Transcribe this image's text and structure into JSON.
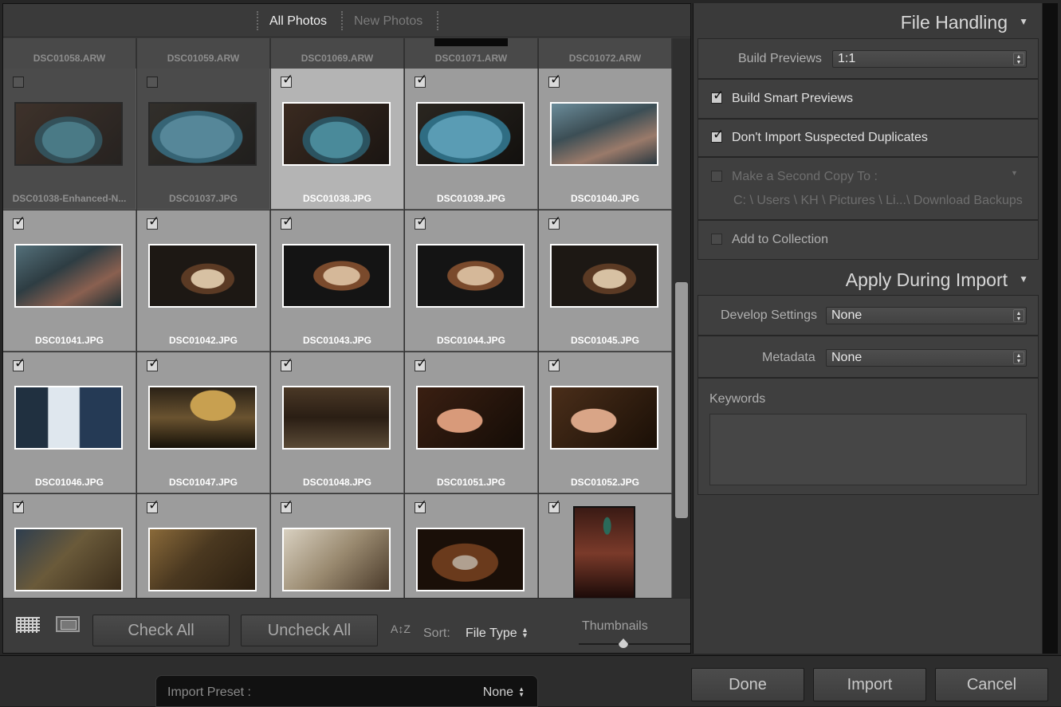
{
  "tabs": {
    "all_photos": "All Photos",
    "new_photos": "New Photos"
  },
  "grid": {
    "top_row_names": [
      "DSC01058.ARW",
      "DSC01059.ARW",
      "DSC01069.ARW",
      "DSC01071.ARW",
      "DSC01072.ARW"
    ],
    "rows": [
      [
        {
          "name": "DSC01038-Enhanced-N...",
          "checked": false,
          "thumb": "t-food1"
        },
        {
          "name": "DSC01037.JPG",
          "checked": false,
          "thumb": "t-food2"
        },
        {
          "name": "DSC01038.JPG",
          "checked": true,
          "selected": true,
          "thumb": "t-food1"
        },
        {
          "name": "DSC01039.JPG",
          "checked": true,
          "thumb": "t-food2"
        },
        {
          "name": "DSC01040.JPG",
          "checked": true,
          "thumb": "t-people"
        }
      ],
      [
        {
          "name": "DSC01041.JPG",
          "checked": true,
          "thumb": "t-people2"
        },
        {
          "name": "DSC01042.JPG",
          "checked": true,
          "thumb": "t-plate"
        },
        {
          "name": "DSC01043.JPG",
          "checked": true,
          "thumb": "t-plate2"
        },
        {
          "name": "DSC01044.JPG",
          "checked": true,
          "thumb": "t-plate2"
        },
        {
          "name": "DSC01045.JPG",
          "checked": true,
          "thumb": "t-plate"
        }
      ],
      [
        {
          "name": "DSC01046.JPG",
          "checked": true,
          "thumb": "t-sign"
        },
        {
          "name": "DSC01047.JPG",
          "checked": true,
          "thumb": "t-zep"
        },
        {
          "name": "DSC01048.JPG",
          "checked": true,
          "thumb": "t-cafe"
        },
        {
          "name": "DSC01051.JPG",
          "checked": true,
          "thumb": "t-hand"
        },
        {
          "name": "DSC01052.JPG",
          "checked": true,
          "thumb": "t-hand2"
        }
      ],
      [
        {
          "name": "",
          "checked": true,
          "thumb": "t-bar"
        },
        {
          "name": "",
          "checked": true,
          "thumb": "t-bar2"
        },
        {
          "name": "",
          "checked": true,
          "thumb": "t-drink"
        },
        {
          "name": "",
          "checked": true,
          "thumb": "t-glass"
        },
        {
          "name": "",
          "checked": true,
          "thumb": "t-hall",
          "portrait": true
        }
      ]
    ]
  },
  "toolbar": {
    "check_all": "Check All",
    "uncheck_all": "Uncheck All",
    "sort_icon": "A↕Z",
    "sort_label": "Sort:",
    "sort_value": "File Type",
    "thumbnails_label": "Thumbnails",
    "thumbnail_size": 0.4
  },
  "file_handling": {
    "title": "File Handling",
    "build_previews_label": "Build Previews",
    "build_previews_value": "1:1",
    "smart_previews_label": "Build Smart Previews",
    "smart_previews_checked": true,
    "no_duplicates_label": "Don't Import Suspected Duplicates",
    "no_duplicates_checked": true,
    "second_copy_label": "Make a Second Copy To :",
    "second_copy_checked": false,
    "second_copy_path": "C: \\ Users \\ KH \\ Pictures \\ Li...\\ Download Backups",
    "add_collection_label": "Add to Collection",
    "add_collection_checked": false
  },
  "apply_during_import": {
    "title": "Apply During Import",
    "develop_label": "Develop Settings",
    "develop_value": "None",
    "metadata_label": "Metadata",
    "metadata_value": "None",
    "keywords_label": "Keywords"
  },
  "footer": {
    "preset_label": "Import Preset :",
    "preset_value": "None",
    "done": "Done",
    "import": "Import",
    "cancel": "Cancel"
  }
}
